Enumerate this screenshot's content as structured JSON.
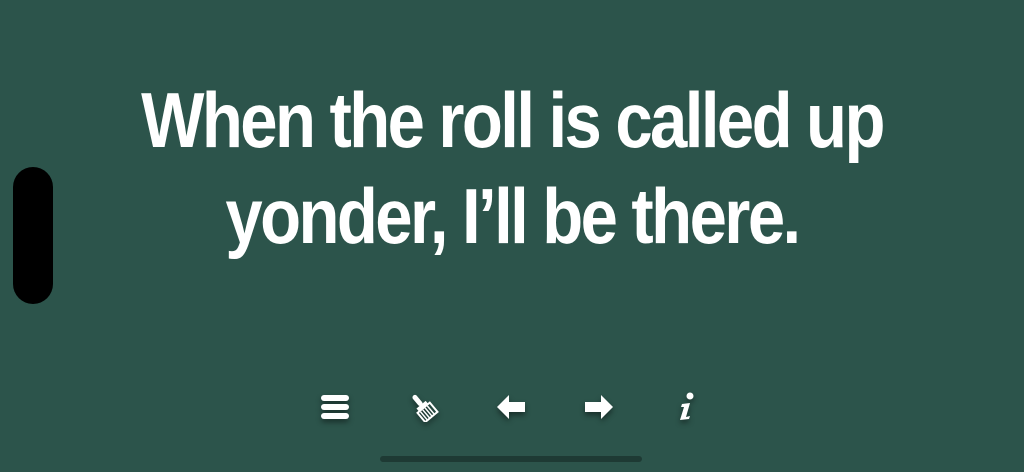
{
  "lyric": {
    "line1": "When the roll is called up",
    "line2": "yonder, I’ll be there."
  },
  "toolbar": {
    "items": [
      {
        "icon": "menu-icon"
      },
      {
        "icon": "paintbrush-icon"
      },
      {
        "icon": "arrow-left-icon"
      },
      {
        "icon": "arrow-right-icon"
      },
      {
        "icon": "info-icon"
      }
    ]
  },
  "colors": {
    "background": "#2c544b",
    "text": "#ffffff",
    "icon": "#ffffff"
  }
}
